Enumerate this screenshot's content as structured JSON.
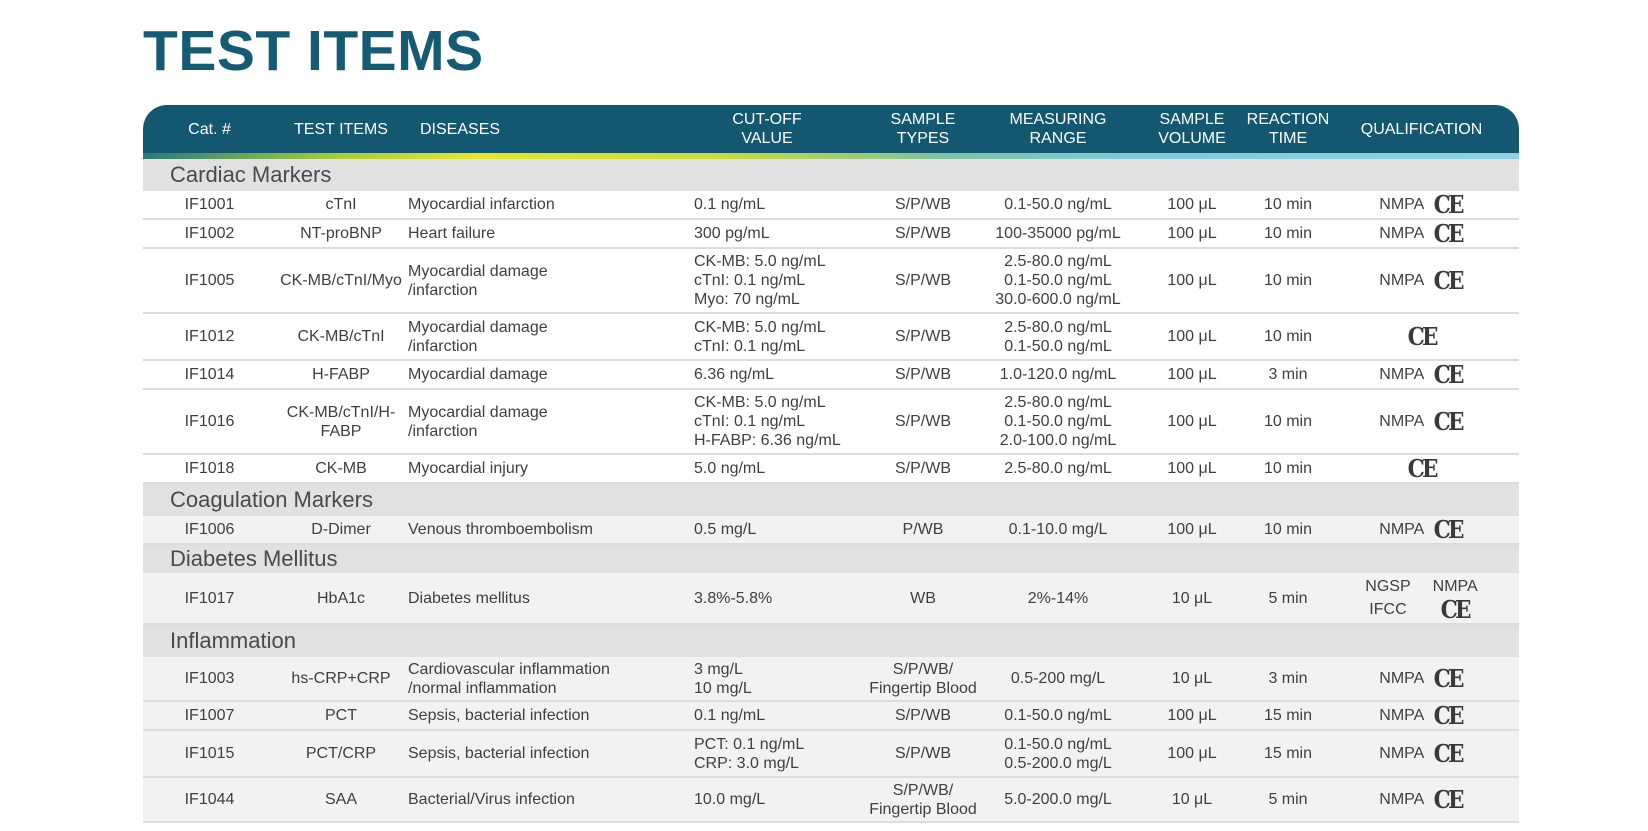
{
  "title": "TEST ITEMS",
  "headers": [
    {
      "label": "Cat. #"
    },
    {
      "label": "TEST ITEMS"
    },
    {
      "label": "DISEASES"
    },
    {
      "label": "CUT-OFF\nVALUE"
    },
    {
      "label": "SAMPLE\nTYPES"
    },
    {
      "label": "MEASURING\nRANGE"
    },
    {
      "label": "SAMPLE\nVOLUME"
    },
    {
      "label": "REACTION\nTIME"
    },
    {
      "label": "QUALIFICATION"
    }
  ],
  "sections": [
    {
      "name": "Cardiac Markers",
      "rows": [
        {
          "cat": "IF1001",
          "item": "cTnI",
          "disease": [
            "Myocardial infarction"
          ],
          "cutoff": [
            "0.1 ng/mL"
          ],
          "sample": [
            "S/P/WB"
          ],
          "range": [
            "0.1-50.0 ng/mL"
          ],
          "volume": "100 μL",
          "time": "10 min",
          "qual": [
            "NMPA",
            "CE"
          ]
        },
        {
          "cat": "IF1002",
          "item": "NT-proBNP",
          "disease": [
            "Heart failure"
          ],
          "cutoff": [
            "300 pg/mL"
          ],
          "sample": [
            "S/P/WB"
          ],
          "range": [
            "100-35000 pg/mL"
          ],
          "volume": "100 μL",
          "time": "10 min",
          "qual": [
            "NMPA",
            "CE"
          ]
        },
        {
          "cat": "IF1005",
          "item": "CK-MB/cTnI/Myo",
          "disease": [
            "Myocardial damage",
            "/infarction"
          ],
          "cutoff": [
            "CK-MB: 5.0 ng/mL",
            "cTnI: 0.1 ng/mL",
            "Myo: 70 ng/mL"
          ],
          "sample": [
            "S/P/WB"
          ],
          "range": [
            "2.5-80.0 ng/mL",
            "0.1-50.0 ng/mL",
            "30.0-600.0 ng/mL"
          ],
          "volume": "100 μL",
          "time": "10 min",
          "qual": [
            "NMPA",
            "CE"
          ]
        },
        {
          "cat": "IF1012",
          "item": "CK-MB/cTnI",
          "disease": [
            "Myocardial damage",
            "/infarction"
          ],
          "cutoff": [
            "CK-MB: 5.0 ng/mL",
            "cTnI: 0.1 ng/mL"
          ],
          "sample": [
            "S/P/WB"
          ],
          "range": [
            "2.5-80.0 ng/mL",
            "0.1-50.0 ng/mL"
          ],
          "volume": "100 μL",
          "time": "10 min",
          "qual": [
            "CE"
          ]
        },
        {
          "cat": "IF1014",
          "item": "H-FABP",
          "disease": [
            "Myocardial damage"
          ],
          "cutoff": [
            "6.36 ng/mL"
          ],
          "sample": [
            "S/P/WB"
          ],
          "range": [
            "1.0-120.0 ng/mL"
          ],
          "volume": "100 μL",
          "time": "3 min",
          "qual": [
            "NMPA",
            "CE"
          ]
        },
        {
          "cat": "IF1016",
          "item": "CK-MB/cTnI/H-FABP",
          "disease": [
            "Myocardial damage",
            "/infarction"
          ],
          "cutoff": [
            "CK-MB: 5.0 ng/mL",
            "cTnI: 0.1 ng/mL",
            "H-FABP: 6.36 ng/mL"
          ],
          "sample": [
            "S/P/WB"
          ],
          "range": [
            "2.5-80.0 ng/mL",
            "0.1-50.0 ng/mL",
            "2.0-100.0 ng/mL"
          ],
          "volume": "100 μL",
          "time": "10 min",
          "qual": [
            "NMPA",
            "CE"
          ]
        },
        {
          "cat": "IF1018",
          "item": "CK-MB",
          "disease": [
            "Myocardial injury"
          ],
          "cutoff": [
            "5.0 ng/mL"
          ],
          "sample": [
            "S/P/WB"
          ],
          "range": [
            "2.5-80.0 ng/mL"
          ],
          "volume": "100 μL",
          "time": "10 min",
          "qual": [
            "CE"
          ]
        }
      ]
    },
    {
      "name": "Coagulation Markers",
      "rows": [
        {
          "cat": "IF1006",
          "item": "D-Dimer",
          "disease": [
            "Venous thromboembolism"
          ],
          "cutoff": [
            "0.5 mg/L"
          ],
          "sample": [
            "P/WB"
          ],
          "range": [
            "0.1-10.0 mg/L"
          ],
          "volume": "100 μL",
          "time": "10 min",
          "qual": [
            "NMPA",
            "CE"
          ]
        }
      ]
    },
    {
      "name": "Diabetes Mellitus",
      "rows": [
        {
          "cat": "IF1017",
          "item": "HbA1c",
          "disease": [
            "Diabetes mellitus"
          ],
          "cutoff": [
            "3.8%-5.8%"
          ],
          "sample": [
            "WB"
          ],
          "range": [
            "2%-14%"
          ],
          "volume": "10 μL",
          "time": "5 min",
          "qual": [
            "NGSP",
            "NMPA",
            "IFCC",
            "CE"
          ]
        }
      ]
    },
    {
      "name": "Inflammation",
      "rows": [
        {
          "cat": "IF1003",
          "item": "hs-CRP+CRP",
          "disease": [
            "Cardiovascular inflammation",
            "/normal inflammation"
          ],
          "cutoff": [
            "3 mg/L",
            "10 mg/L"
          ],
          "sample": [
            "S/P/WB/",
            "Fingertip Blood"
          ],
          "range": [
            "0.5-200 mg/L"
          ],
          "volume": "10 μL",
          "time": "3 min",
          "qual": [
            "NMPA",
            "CE"
          ]
        },
        {
          "cat": "IF1007",
          "item": "PCT",
          "disease": [
            "Sepsis, bacterial infection"
          ],
          "cutoff": [
            "0.1 ng/mL"
          ],
          "sample": [
            "S/P/WB"
          ],
          "range": [
            "0.1-50.0 ng/mL"
          ],
          "volume": "100 μL",
          "time": "15 min",
          "qual": [
            "NMPA",
            "CE"
          ]
        },
        {
          "cat": "IF1015",
          "item": "PCT/CRP",
          "disease": [
            "Sepsis, bacterial infection"
          ],
          "cutoff": [
            "PCT: 0.1 ng/mL",
            "CRP: 3.0 mg/L"
          ],
          "sample": [
            "S/P/WB"
          ],
          "range": [
            "0.1-50.0 ng/mL",
            "0.5-200.0 mg/L"
          ],
          "volume": "100 μL",
          "time": "15 min",
          "qual": [
            "NMPA",
            "CE"
          ]
        },
        {
          "cat": "IF1044",
          "item": "SAA",
          "disease": [
            "Bacterial/Virus infection"
          ],
          "cutoff": [
            "10.0 mg/L"
          ],
          "sample": [
            "S/P/WB/",
            "Fingertip Blood"
          ],
          "range": [
            "5.0-200.0 mg/L"
          ],
          "volume": "10 μL",
          "time": "5 min",
          "qual": [
            "NMPA",
            "CE"
          ]
        }
      ]
    }
  ],
  "colors": {
    "brand": "#165b74",
    "header_bg": "#135870",
    "section_bg": "#e1e1e1"
  }
}
